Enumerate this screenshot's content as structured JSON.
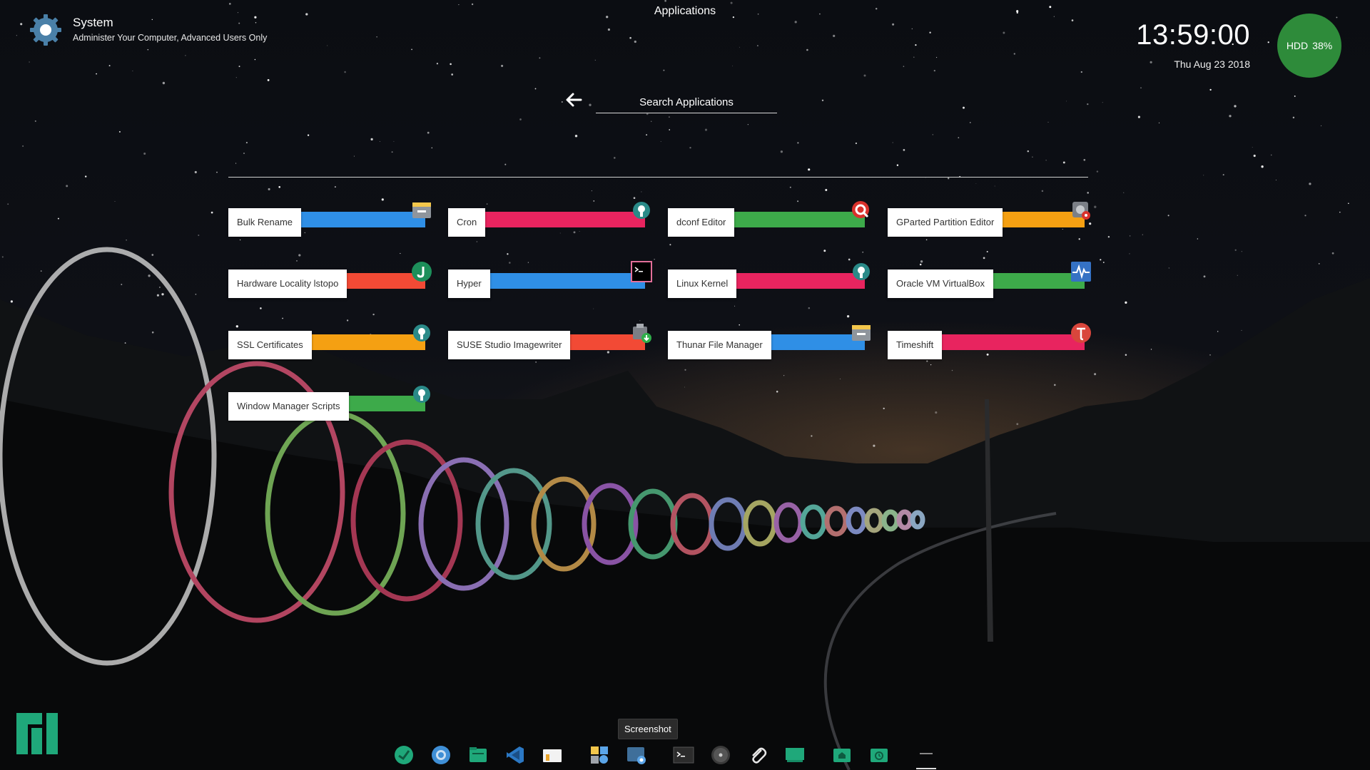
{
  "window": {
    "title": "Applications"
  },
  "category": {
    "title": "System",
    "subtitle": "Administer Your Computer, Advanced Users Only",
    "icon": "gear-icon"
  },
  "clock": {
    "time": "13:59:00",
    "date": "Thu Aug 23 2018"
  },
  "hdd": {
    "label": "HDD",
    "value": "38%",
    "color": "#2e8b3a"
  },
  "search": {
    "placeholder": "Search Applications",
    "back_icon": "back-arrow-icon"
  },
  "apps": [
    {
      "name": "Bulk Rename",
      "color": "#2f8fe6",
      "icon": "file-manager-icon"
    },
    {
      "name": "Cron",
      "color": "#e8245f",
      "icon": "settings-plug-icon"
    },
    {
      "name": "dconf Editor",
      "color": "#3daa4a",
      "icon": "search-red-icon"
    },
    {
      "name": "GParted Partition Editor",
      "color": "#f5a012",
      "icon": "disk-gear-icon"
    },
    {
      "name": "Hardware Locality lstopo",
      "color": "#f24a35",
      "icon": "j-circle-icon"
    },
    {
      "name": "Hyper",
      "color": "#2f8fe6",
      "icon": "terminal-icon"
    },
    {
      "name": "Linux Kernel",
      "color": "#e8245f",
      "icon": "settings-plug-icon"
    },
    {
      "name": "Oracle VM VirtualBox",
      "color": "#3daa4a",
      "icon": "pulse-monitor-icon"
    },
    {
      "name": "SSL Certificates",
      "color": "#f5a012",
      "icon": "settings-plug-icon"
    },
    {
      "name": "SUSE Studio Imagewriter",
      "color": "#f24a35",
      "icon": "usb-drive-icon"
    },
    {
      "name": "Thunar File Manager",
      "color": "#2f8fe6",
      "icon": "file-manager-icon"
    },
    {
      "name": "Timeshift",
      "color": "#e8245f",
      "icon": "timeshift-icon"
    },
    {
      "name": "Window Manager Scripts",
      "color": "#3daa4a",
      "icon": "settings-plug-icon"
    }
  ],
  "tooltip": "Screenshot",
  "dock": [
    "mail-icon",
    "browser-icon",
    "files-icon",
    "code-editor-icon",
    "archive-icon",
    "photos-icon",
    "screenshot-icon",
    "terminal-icon",
    "disc-icon",
    "attachment-icon",
    "monitor-icon",
    "home-folder-icon",
    "timer-folder-icon",
    "dash-icon"
  ],
  "logo": "manjaro-logo-icon"
}
